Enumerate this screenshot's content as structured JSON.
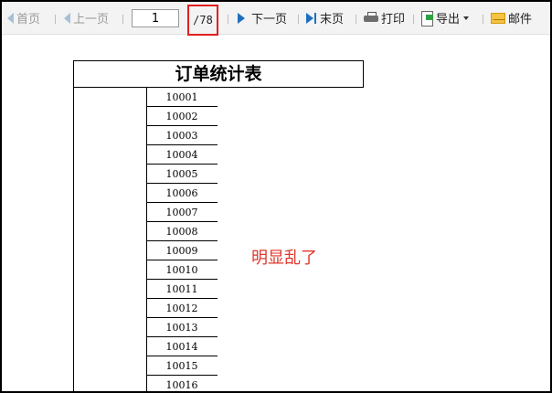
{
  "toolbar": {
    "first_label": "首页",
    "prev_label": "上一页",
    "page_value": "1",
    "total_pages": "/78",
    "next_label": "下一页",
    "last_label": "末页",
    "print_label": "打印",
    "export_label": "导出",
    "mail_label": "邮件"
  },
  "report": {
    "title": "订单统计表",
    "rows": [
      "10001",
      "10002",
      "10003",
      "10004",
      "10005",
      "10006",
      "10007",
      "10008",
      "10009",
      "10010",
      "10011",
      "10012",
      "10013",
      "10014",
      "10015",
      "10016"
    ]
  },
  "annotation": "明显乱了",
  "colors": {
    "highlight_box": "#e02020",
    "annotation": "#e0352b",
    "nav_accent": "#1f6fbf"
  }
}
